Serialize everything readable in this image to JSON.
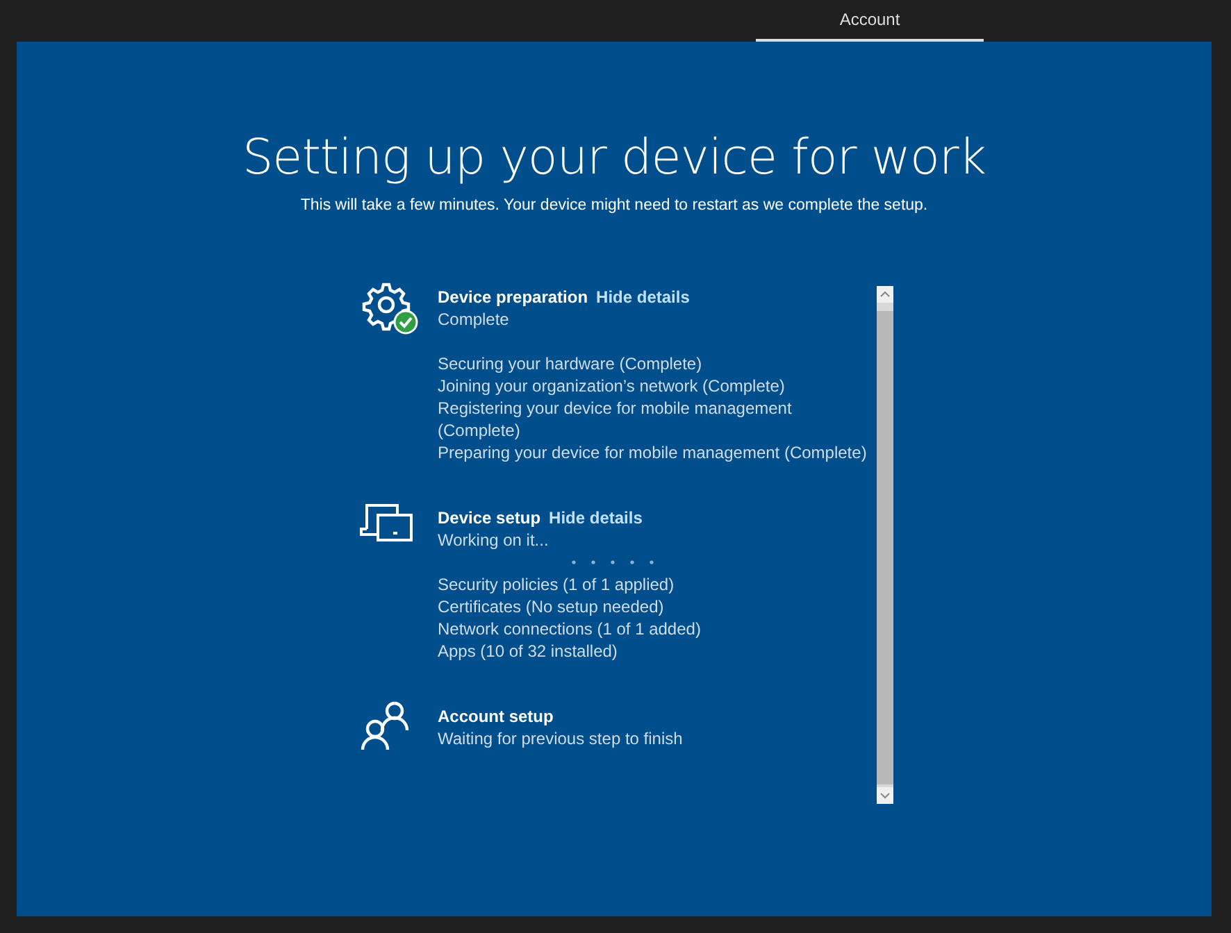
{
  "tabs": [
    {
      "label": "Account",
      "selected": true
    }
  ],
  "title": "Setting up your device for work",
  "subtitle": "This will take a few minutes. Your device might need to restart as we complete the setup.",
  "steps": [
    {
      "kind": "gear",
      "done": true,
      "name": "Device preparation",
      "link": "Hide details",
      "status": "Complete",
      "busy": false,
      "details": [
        "Securing your hardware (Complete)",
        "Joining your organization’s network (Complete)",
        "Registering your device for mobile management (Complete)",
        "Preparing your device for mobile management (Complete)"
      ]
    },
    {
      "kind": "devices",
      "done": false,
      "name": "Device setup",
      "link": "Hide details",
      "status": "Working on it...",
      "busy": true,
      "details": [
        "Security policies (1 of 1 applied)",
        "Certificates (No setup needed)",
        "Network connections (1 of 1 added)",
        "Apps (10 of 32 installed)"
      ]
    },
    {
      "kind": "people",
      "done": false,
      "name": "Account setup",
      "status": "Waiting for previous step to finish",
      "busy": false
    }
  ]
}
